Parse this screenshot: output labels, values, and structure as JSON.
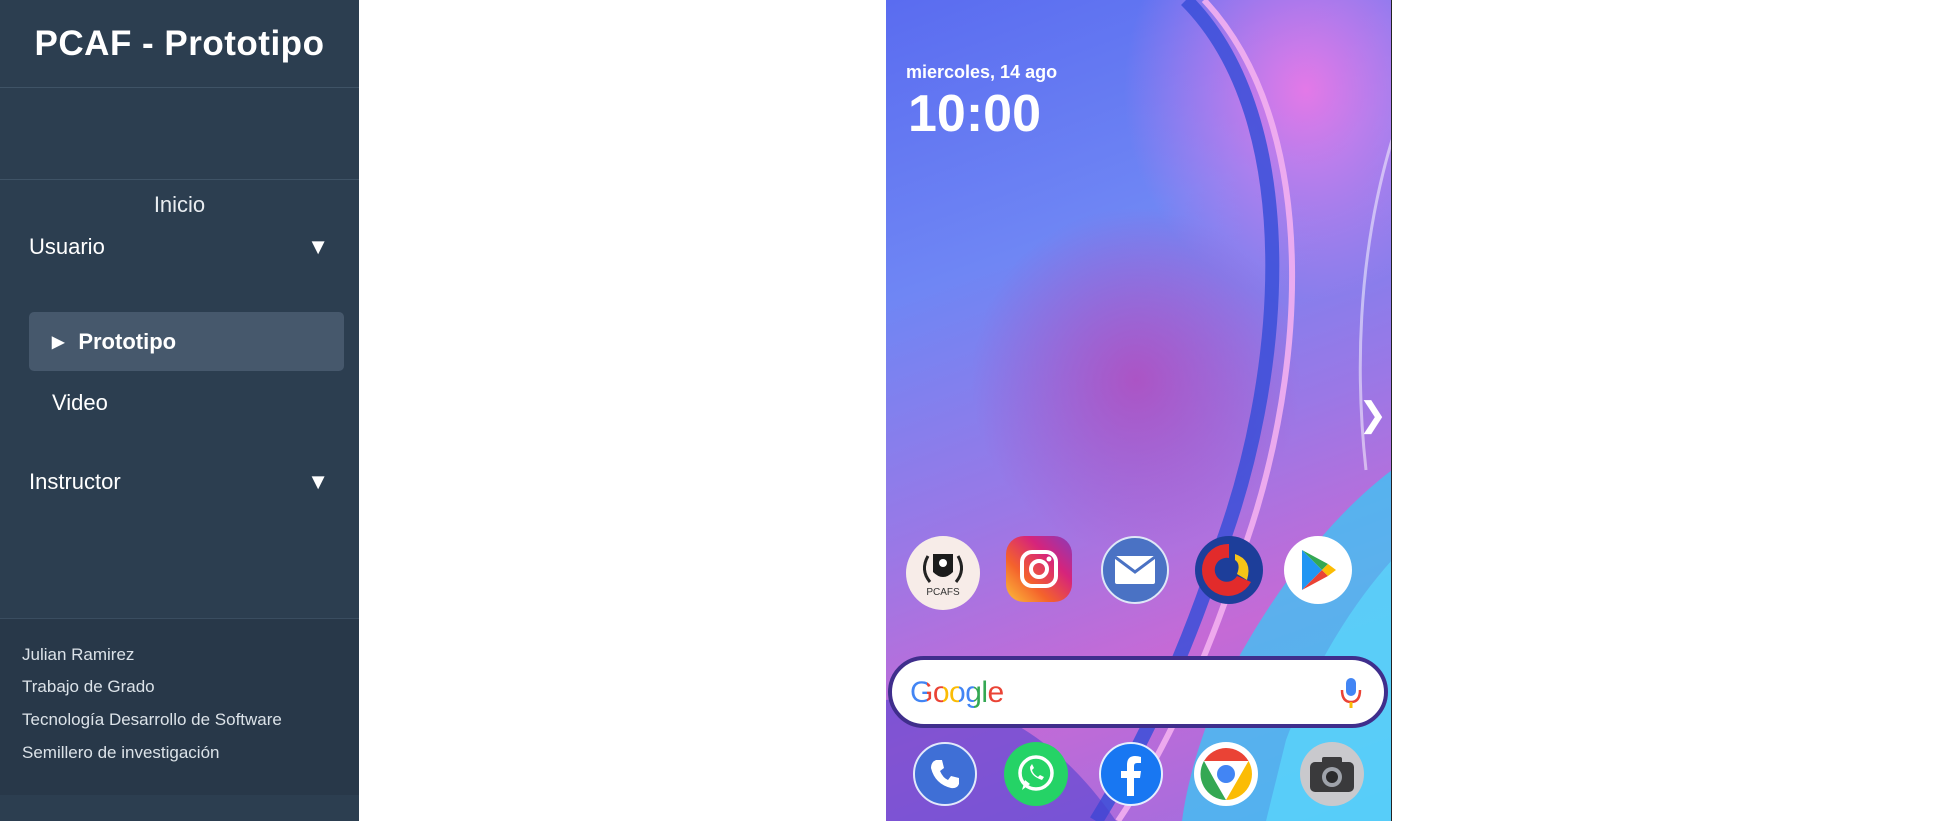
{
  "sidebar": {
    "title": "PCAF - Prototipo",
    "nav": {
      "home": "Inicio",
      "usuario": {
        "label": "Usuario",
        "caret": "▼"
      },
      "prototipo": {
        "label": "Prototipo",
        "marker": "▶"
      },
      "video": {
        "label": "Video"
      },
      "instructor": {
        "label": "Instructor",
        "caret": "▼"
      }
    },
    "footer": [
      "Julian Ramirez",
      "Trabajo de Grado",
      "Tecnología Desarrollo de Software",
      "Semillero de investigación"
    ]
  },
  "phone": {
    "date": "miercoles, 14 ago",
    "time": "10:00",
    "next_arrow": "❯",
    "apps": [
      "pcafs-app",
      "instagram-app",
      "mail-app",
      "bank-app",
      "play-store-app"
    ],
    "pcafs_label": "PCAFS",
    "search": {
      "logo": "Google"
    },
    "dock": [
      "phone-app",
      "whatsapp-app",
      "facebook-app",
      "chrome-app",
      "camera-app"
    ]
  },
  "colors": {
    "sidebar_bg": "#2c3e50",
    "active_item_bg": "#46586c",
    "footer_bg": "#283849"
  }
}
